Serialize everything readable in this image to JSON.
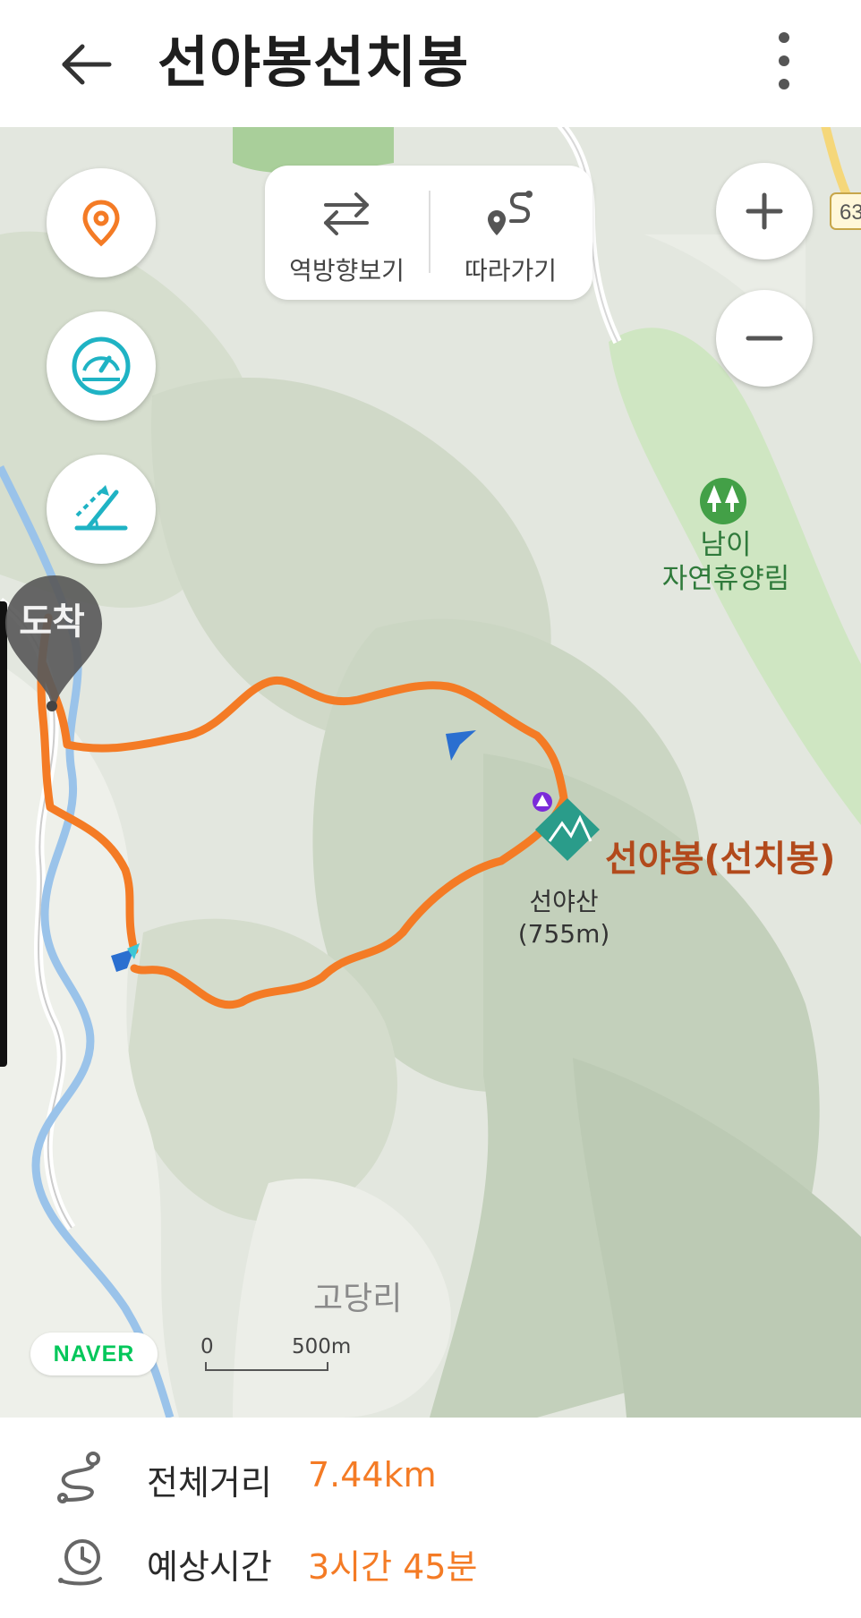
{
  "header": {
    "title": "선야봉선치봉",
    "back_icon": "arrow-left-icon",
    "more_icon": "more-vertical-icon"
  },
  "map": {
    "controls": {
      "location_icon": "location-pin-icon",
      "speed_icon": "speedometer-icon",
      "slope_icon": "slope-icon",
      "zoom_in_icon": "plus-icon",
      "zoom_out_icon": "minus-icon"
    },
    "tools": [
      {
        "label": "역방향보기",
        "icon": "swap-arrows-icon"
      },
      {
        "label": "따라가기",
        "icon": "route-follow-icon"
      }
    ],
    "arrive_label": "도착",
    "road_number": "63",
    "labels": {
      "forest_line1": "남이",
      "forest_line2": "자연휴양림",
      "peak": "선야봉(선치봉)",
      "mountain_line1": "선야산",
      "mountain_line2": "(755m)",
      "village": "고당리"
    },
    "logo": "NAVER",
    "scale": {
      "zero": "0",
      "distance": "500m"
    },
    "colors": {
      "route": "#f47b25",
      "peak_marker": "#2a9c8a",
      "forest_badge": "#43a047"
    }
  },
  "summary": {
    "distance_label": "전체거리",
    "distance_value": "7.44km",
    "time_label": "예상시간",
    "time_value": "3시간 45분",
    "accent_color": "#f47b25"
  }
}
